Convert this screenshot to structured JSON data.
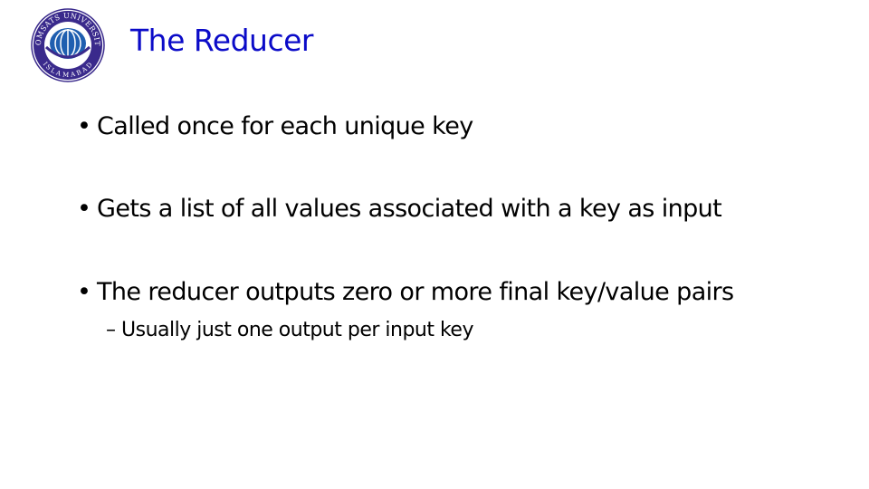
{
  "slide": {
    "title": "The Reducer",
    "logo": {
      "icon": "university-seal-icon",
      "top_text": "COMSATS UNIVERSITY",
      "bottom_text": "ISLAMABAD"
    },
    "bullets": [
      {
        "marker": "•",
        "text": "Called once for each unique key"
      },
      {
        "marker": "•",
        "text": "Gets a list of all values associated with a key as input"
      },
      {
        "marker": "•",
        "text": "The reducer outputs zero or more final key/value pairs"
      }
    ],
    "sub_bullets": [
      {
        "marker": "–",
        "text": "Usually just one output per input key"
      }
    ]
  },
  "colors": {
    "title": "#0b0bc8",
    "logo_ring": "#3a2a8c",
    "logo_globe": "#1f5fb0",
    "body_text": "#000000"
  }
}
